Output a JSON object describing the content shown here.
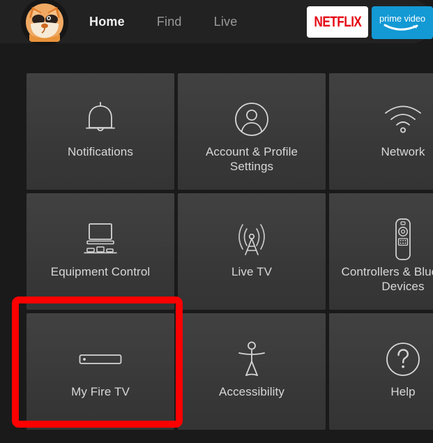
{
  "header": {
    "avatar": {
      "name": "user-profile-avatar",
      "description": "cartoon fox profile picture"
    },
    "nav": [
      {
        "label": "Home",
        "active": true
      },
      {
        "label": "Find",
        "active": false
      },
      {
        "label": "Live",
        "active": false
      }
    ],
    "apps": [
      {
        "name": "netflix",
        "label": "NETFLIX",
        "bg": "#ffffff",
        "fg": "#e50914"
      },
      {
        "name": "prime-video",
        "label": "prime video",
        "bg": "#1399d4",
        "fg": "#ffffff"
      }
    ]
  },
  "grid": {
    "rows": [
      [
        {
          "label": "Notifications",
          "icon": "bell-icon"
        },
        {
          "label": "Account & Profile Settings",
          "icon": "person-circle-icon"
        },
        {
          "label": "Network",
          "icon": "wifi-icon"
        }
      ],
      [
        {
          "label": "Equipment Control",
          "icon": "tv-equipment-icon"
        },
        {
          "label": "Live TV",
          "icon": "broadcast-tower-icon"
        },
        {
          "label": "Controllers & Bluetooth Devices",
          "icon": "remote-control-icon"
        }
      ],
      [
        {
          "label": "My Fire TV",
          "icon": "fire-tv-stick-icon"
        },
        {
          "label": "Accessibility",
          "icon": "accessibility-person-icon"
        },
        {
          "label": "Help",
          "icon": "question-circle-icon"
        }
      ]
    ]
  },
  "highlight": {
    "target": "My Fire TV",
    "color": "#fd0000"
  }
}
